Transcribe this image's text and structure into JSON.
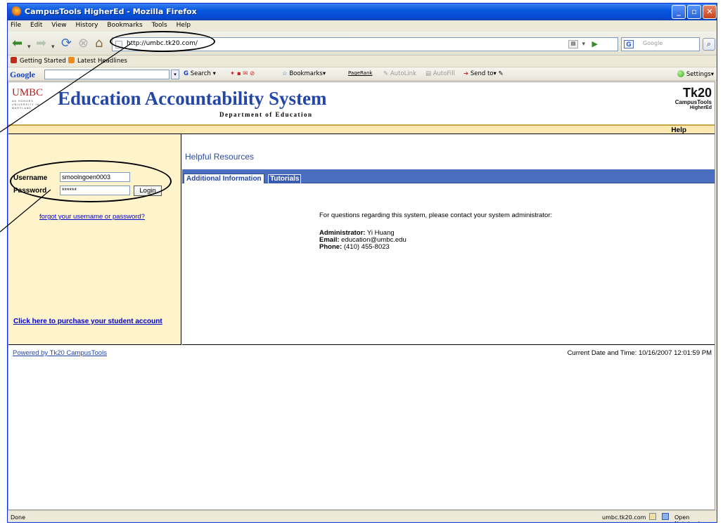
{
  "browser": {
    "title": "CampusTools HigherEd - Mozilla Firefox",
    "menu": [
      "File",
      "Edit",
      "View",
      "History",
      "Bookmarks",
      "Tools",
      "Help"
    ],
    "url": "http://umbc.tk20.com/",
    "search_placeholder": "Google",
    "bookmarks": [
      "Getting Started",
      "Latest Headlines"
    ],
    "google_toolbar": {
      "search_label": "Search",
      "bookmarks_label": "Bookmarks",
      "pagerank_label": "PageRank",
      "autolink_label": "AutoLink",
      "autofill_label": "AutoFill",
      "sendto_label": "Send to",
      "settings_label": "Settings"
    },
    "status": {
      "left": "Done",
      "host": "umbc.tk20.com",
      "notebook": "Open Notebook"
    }
  },
  "page": {
    "logo_umbc": "UMBC",
    "logo_umbc_sub": "AN HONORS UNIVERSITY IN MARYLAND",
    "title": "Education Accountability System",
    "department": "Department of Education",
    "tk20_logo": "Tk20",
    "tk20_sub1": "CampusTools",
    "tk20_sub2": "HigherEd",
    "help": "Help",
    "login": {
      "username_label": "Username",
      "username_value": "smoolngoen0003",
      "password_label": "Password",
      "password_value": "******",
      "login_button": "Login",
      "forgot_link": "forgot your username or password?",
      "purchase_link": "Click here to purchase your student account"
    },
    "section_title": "Helpful Resources",
    "tabs": [
      "Additional Information",
      "Tutorials"
    ],
    "message": "For questions regarding this system, please contact your system administrator:",
    "contact": {
      "admin_label": "Administrator:",
      "admin_value": "Yi Huang",
      "email_label": "Email:",
      "email_value": "education@umbc.edu",
      "phone_label": "Phone:",
      "phone_value": "(410) 455-8023"
    },
    "footer_link": "Powered by Tk20 CampusTools",
    "datetime": "Current Date and Time: 10/16/2007 12:01:59 PM"
  }
}
